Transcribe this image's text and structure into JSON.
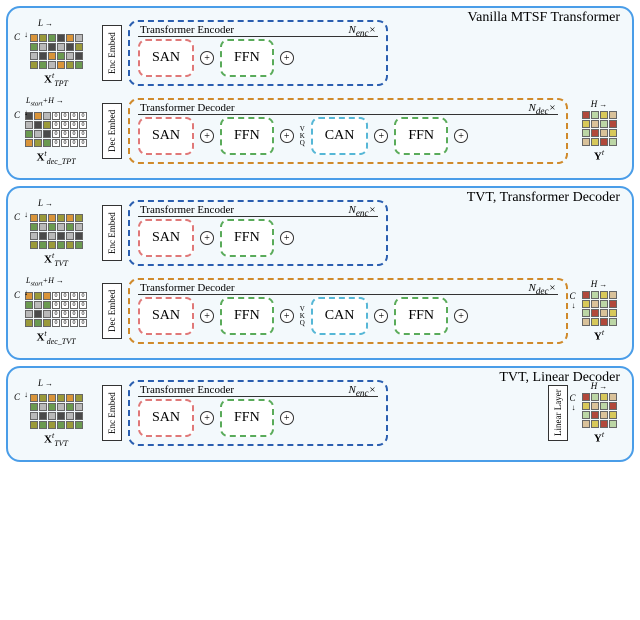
{
  "panels": {
    "vanilla": {
      "title": "Vanilla MTSF Transformer",
      "encoder": {
        "label": "Transformer Encoder",
        "repeat": "N_enc ×",
        "modules": [
          "SAN",
          "FFN"
        ],
        "embed": "Enc Embed",
        "input_var": "X_TPT^t",
        "dim_l": "L",
        "dim_c": "C"
      },
      "decoder": {
        "label": "Transformer Decoder",
        "repeat": "N_dec ×",
        "modules": [
          "SAN",
          "FFN",
          "CAN",
          "FFN"
        ],
        "kvq": [
          "V",
          "K",
          "Q"
        ],
        "embed": "Dec Embed",
        "input_var": "X_dec_TPT^t",
        "dim_l": "L_start + H",
        "dim_c": "C",
        "out_var": "Y^t",
        "out_dim": "H"
      }
    },
    "tvt_trans": {
      "title": "TVT, Transformer Decoder",
      "encoder": {
        "label": "Transformer Encoder",
        "repeat": "N_enc ×",
        "modules": [
          "SAN",
          "FFN"
        ],
        "embed": "Enc Embed",
        "input_var": "X_TVT^t",
        "dim_l": "L",
        "dim_c": "C"
      },
      "decoder": {
        "label": "Transformer Decoder",
        "repeat": "N_dec ×",
        "modules": [
          "SAN",
          "FFN",
          "CAN",
          "FFN"
        ],
        "kvq": [
          "V",
          "K",
          "Q"
        ],
        "embed": "Dec Embed",
        "input_var": "X_dec_TVT^t",
        "dim_l": "L_start + H",
        "dim_c": "C",
        "out_var": "Y^t",
        "out_dim": "H",
        "out_dim_c": "C"
      }
    },
    "tvt_linear": {
      "title": "TVT, Linear Decoder",
      "encoder": {
        "label": "Transformer Encoder",
        "repeat": "N_enc ×",
        "modules": [
          "SAN",
          "FFN"
        ],
        "embed": "Enc Embed",
        "input_var": "X_TVT^t",
        "dim_l": "L",
        "dim_c": "C",
        "linear": "Linear Layer",
        "out_var": "Y^t",
        "out_dim": "H",
        "out_dim_c": "C"
      }
    }
  },
  "colors": {
    "panel_border": "#4a9de8",
    "enc_border": "#2b5fb0",
    "dec_border": "#d08a2b",
    "san_border": "#e07878",
    "ffn_border": "#5aab5a",
    "can_border": "#56b7d6"
  },
  "ops": {
    "add": "+"
  },
  "zero_token": "0"
}
